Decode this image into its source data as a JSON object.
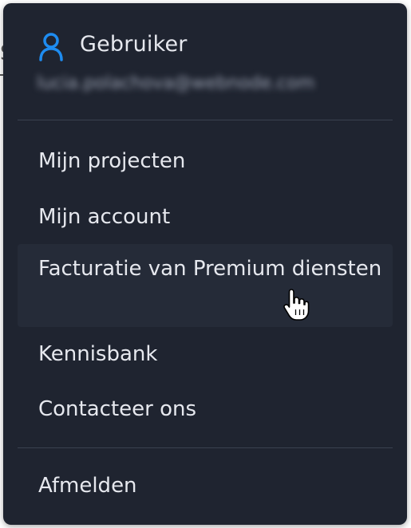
{
  "behind": {
    "glyph": "S"
  },
  "menu": {
    "header": {
      "title": "Gebruiker",
      "email": "lucia.polachova@webnode.com",
      "icon": "user-icon",
      "accent": "#1e8cf0"
    },
    "items": [
      {
        "label": "Mijn projecten"
      },
      {
        "label": "Mijn account"
      },
      {
        "label": "Facturatie van Premium diensten",
        "hovered": true
      },
      {
        "label": "Kennisbank"
      },
      {
        "label": "Contacteer ons"
      }
    ],
    "footer": {
      "label": "Afmelden"
    }
  },
  "colors": {
    "background": "#1f2430",
    "hover": "#252b38",
    "text": "#e6e8ee",
    "divider": "#3a4150"
  }
}
